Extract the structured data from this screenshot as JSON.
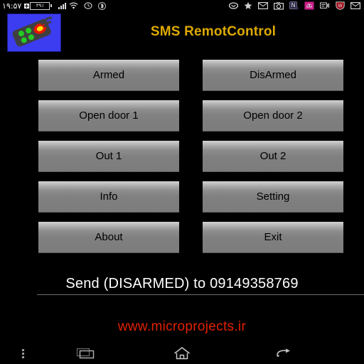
{
  "status_bar": {
    "clock": "۱۹:۵۷",
    "battery_percent": "۳۹٪",
    "battery_icon": "battery-charging-icon",
    "signal_icon": "cellular-signal-icon",
    "wifi_icon": "wifi-icon",
    "alarm_icon": "alarm-clock-icon",
    "bluetooth_icon": "bluetooth-icon",
    "notification_icons": [
      "chat-bubble-icon",
      "star-icon",
      "envelope-icon",
      "camera-icon",
      "n-badge-icon",
      "pink-app-icon",
      "message-icon",
      "shield-badge-icon",
      "mail-icon"
    ]
  },
  "header": {
    "title": "SMS RemotControl",
    "title_color": "#ddaa00",
    "icon_name": "remote-control-app-icon",
    "icon_background": "#3c3cf0"
  },
  "buttons": {
    "rows": [
      {
        "left": "Armed",
        "right": "DisArmed"
      },
      {
        "left": "Open door 1",
        "right": "Open door 2"
      },
      {
        "left": "Out 1",
        "right": "Out 2"
      },
      {
        "left": "Info",
        "right": "Setting"
      },
      {
        "left": "About",
        "right": "Exit"
      }
    ]
  },
  "status_line": {
    "text": "Send (DISARMED) to 09149358769",
    "color": "#ffffff"
  },
  "footer": {
    "website": "www.microprojects.ir",
    "website_color": "#e02200"
  },
  "nav_bar": {
    "menu_icon": "overflow-menu-icon",
    "recents_icon": "recent-apps-icon",
    "home_icon": "home-icon",
    "back_icon": "back-arrow-icon"
  }
}
